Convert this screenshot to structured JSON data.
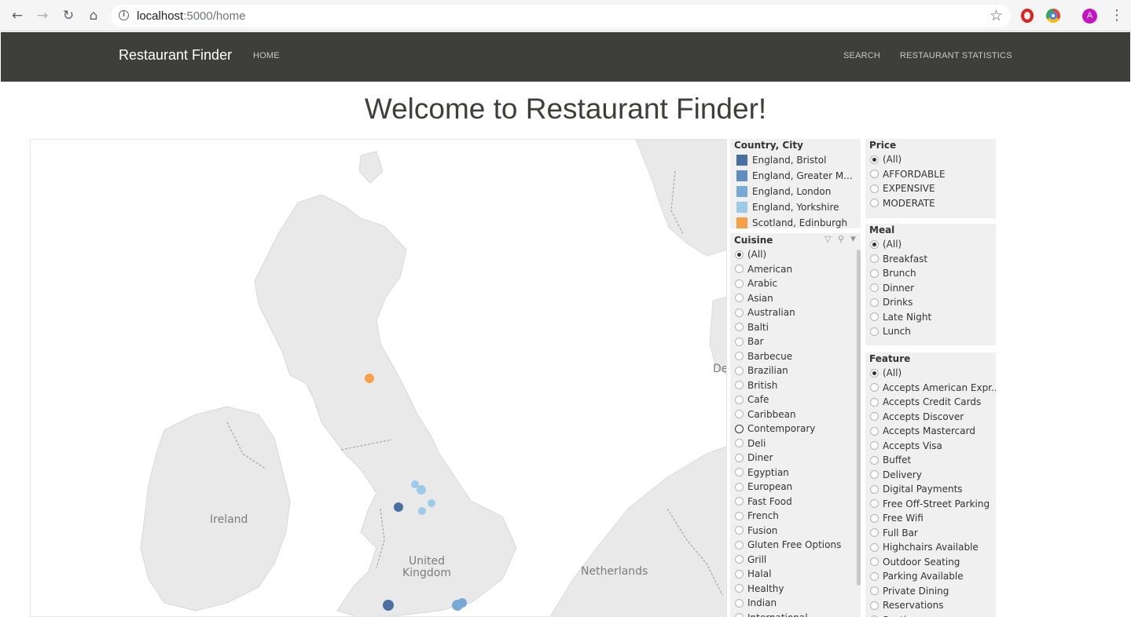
{
  "browser": {
    "url_host": "localhost",
    "url_path": ":5000/home",
    "avatar_letter": "A"
  },
  "navbar": {
    "brand": "Restaurant Finder",
    "home": "HOME",
    "search": "SEARCH",
    "stats": "RESTAURANT STATISTICS"
  },
  "page": {
    "title": "Welcome to Restaurant Finder!"
  },
  "map": {
    "labels": {
      "ireland": "Ireland",
      "uk_line1": "United",
      "uk_line2": "Kingdom",
      "netherlands": "Netherlands",
      "de_partial": "De"
    }
  },
  "country_city": {
    "title": "Country, City",
    "items": [
      {
        "label": "England, Bristol",
        "color": "#4a6fa0"
      },
      {
        "label": "England, Greater M...",
        "color": "#5e8cc3"
      },
      {
        "label": "England, London",
        "color": "#78a9d6"
      },
      {
        "label": "England, Yorkshire",
        "color": "#9ccbea"
      },
      {
        "label": "Scotland, Edinburgh",
        "color": "#f7a047"
      }
    ]
  },
  "cuisine": {
    "title": "Cuisine",
    "options": [
      "(All)",
      "American",
      "Arabic",
      "Asian",
      "Australian",
      "Balti",
      "Bar",
      "Barbecue",
      "Brazilian",
      "British",
      "Cafe",
      "Caribbean",
      "Contemporary",
      "Deli",
      "Diner",
      "Egyptian",
      "European",
      "Fast Food",
      "French",
      "Fusion",
      "Gluten Free Options",
      "Grill",
      "Halal",
      "Healthy",
      "Indian",
      "International"
    ],
    "selected": "(All)",
    "hovered": "Contemporary"
  },
  "price": {
    "title": "Price",
    "options": [
      "(All)",
      "AFFORDABLE",
      "EXPENSIVE",
      "MODERATE"
    ],
    "selected": "(All)"
  },
  "meal": {
    "title": "Meal",
    "options": [
      "(All)",
      "Breakfast",
      "Brunch",
      "Dinner",
      "Drinks",
      "Late Night",
      "Lunch"
    ],
    "selected": "(All)"
  },
  "feature": {
    "title": "Feature",
    "options": [
      "(All)",
      "Accepts American Expr...",
      "Accepts Credit Cards",
      "Accepts Discover",
      "Accepts Mastercard",
      "Accepts Visa",
      "Buffet",
      "Delivery",
      "Digital Payments",
      "Free Off-Street Parking",
      "Free Wifi",
      "Full Bar",
      "Highchairs Available",
      "Outdoor Seating",
      "Parking Available",
      "Private Dining",
      "Reservations",
      "Seating"
    ],
    "selected": "(All)"
  }
}
